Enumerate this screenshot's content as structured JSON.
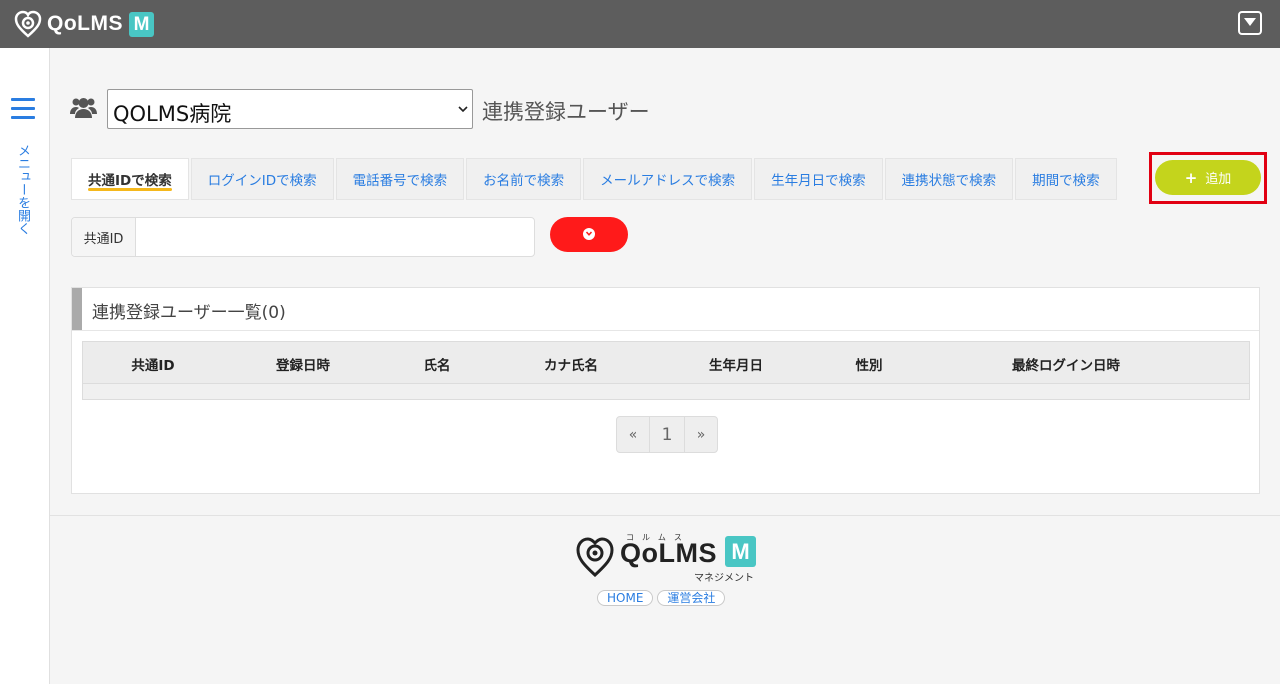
{
  "app": {
    "brand": "QoLMS",
    "brand_badge": "M"
  },
  "sidebar": {
    "open_menu_label": "メニューを開く"
  },
  "header": {
    "hospital_selected": "QOLMS病院",
    "page_title": "連携登録ユーザー"
  },
  "tabs": [
    {
      "label": "共通IDで検索",
      "active": true
    },
    {
      "label": "ログインIDで検索",
      "active": false
    },
    {
      "label": "電話番号で検索",
      "active": false
    },
    {
      "label": "お名前で検索",
      "active": false
    },
    {
      "label": "メールアドレスで検索",
      "active": false
    },
    {
      "label": "生年月日で検索",
      "active": false
    },
    {
      "label": "連携状態で検索",
      "active": false
    },
    {
      "label": "期間で検索",
      "active": false
    }
  ],
  "add_button": {
    "label": "追加"
  },
  "search": {
    "field_label": "共通ID",
    "value": "",
    "placeholder": ""
  },
  "list": {
    "title": "連携登録ユーザー一覧(0)",
    "columns": [
      "共通ID",
      "登録日時",
      "氏名",
      "カナ氏名",
      "生年月日",
      "性別",
      "最終ログイン日時"
    ],
    "rows": []
  },
  "pagination": {
    "prev": "«",
    "current": "1",
    "next": "»"
  },
  "footer": {
    "brand": "QoLMS",
    "brand_ruby": "コルムス",
    "brand_badge": "M",
    "brand_sub": "マネジメント",
    "links": [
      "HOME",
      "運営会社"
    ]
  },
  "colors": {
    "topbar": "#5d5d5d",
    "accent_blue": "#2a7de1",
    "add_button": "#c4d41c",
    "search_button": "#ff1a1a",
    "highlight_border": "#e10012",
    "logo_teal": "#49c6c4"
  }
}
